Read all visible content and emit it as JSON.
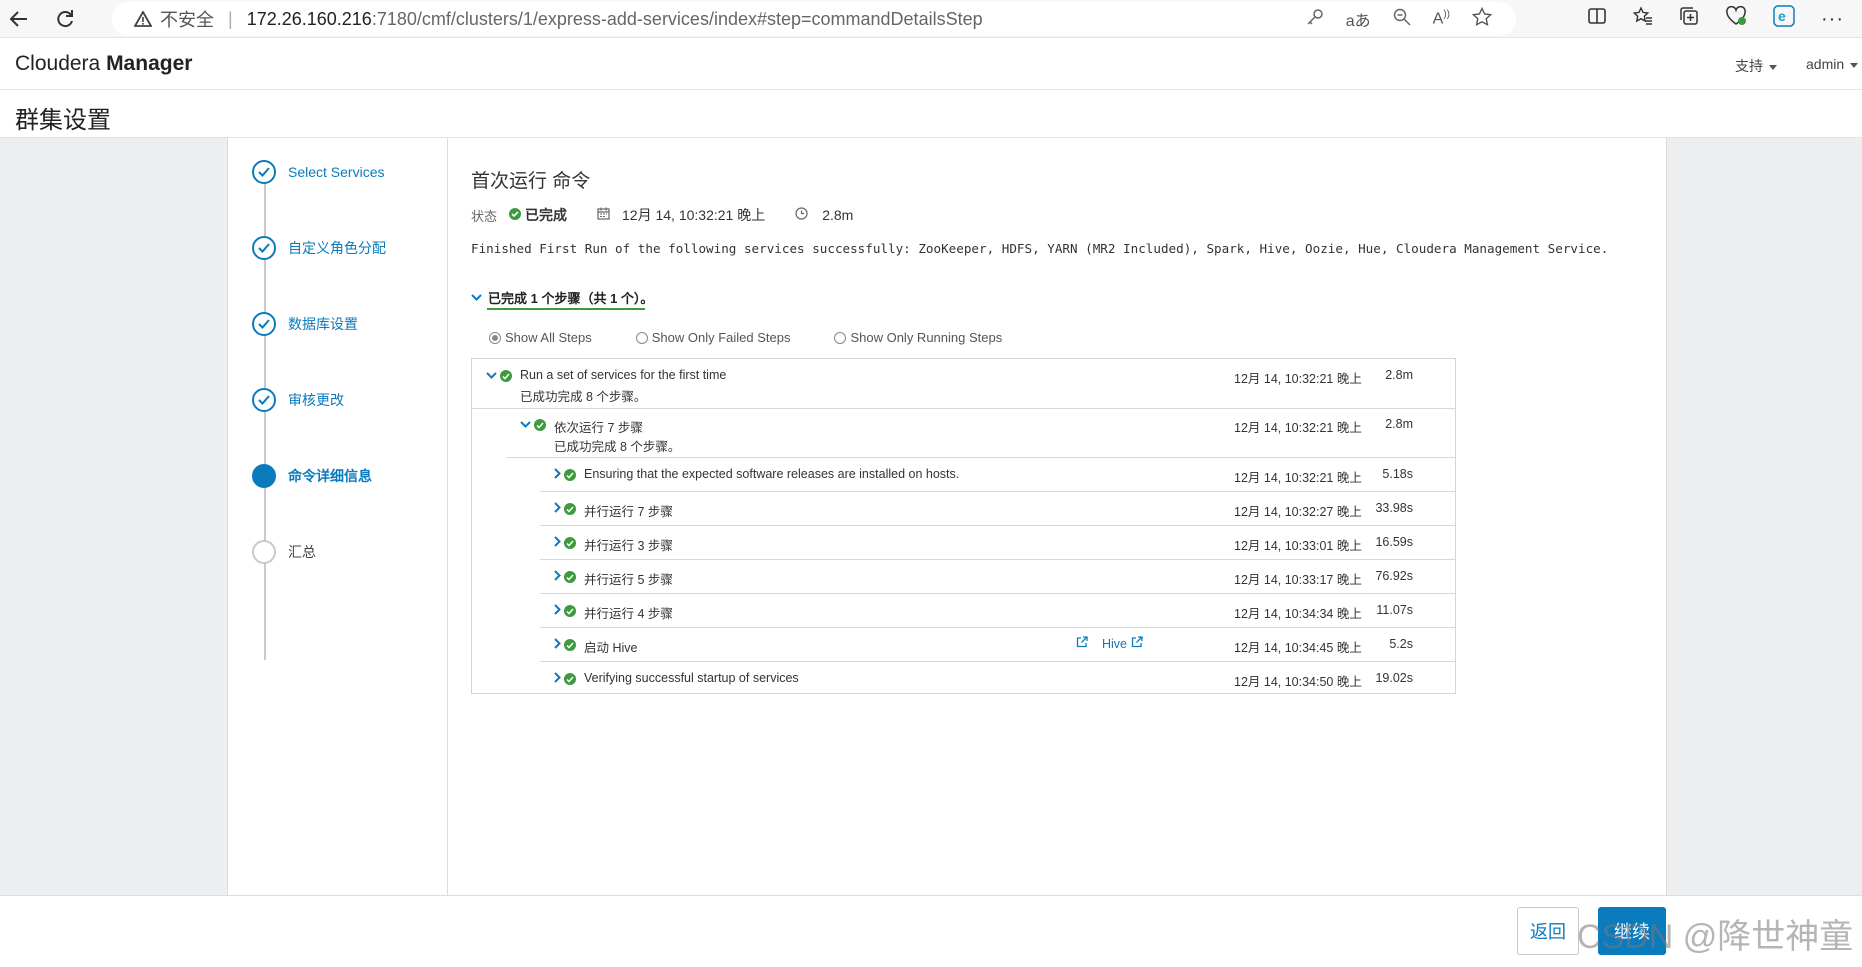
{
  "browser": {
    "insecure_label": "不安全",
    "url_host": "172.26.160.216",
    "url_path": ":7180/cmf/clusters/1/express-add-services/index#step=commandDetailsStep"
  },
  "header": {
    "brand_light": "Cloudera ",
    "brand_bold": "Manager",
    "support_label": "支持",
    "user_label": "admin"
  },
  "page": {
    "title": "群集设置"
  },
  "wizard_steps": [
    {
      "label": "Select Services",
      "state": "done"
    },
    {
      "label": "自定义角色分配",
      "state": "done"
    },
    {
      "label": "数据库设置",
      "state": "done"
    },
    {
      "label": "审核更改",
      "state": "done"
    },
    {
      "label": "命令详细信息",
      "state": "active"
    },
    {
      "label": "汇总",
      "state": "pending"
    }
  ],
  "command": {
    "title": "首次运行 命令",
    "status_label": "状态",
    "status_value": "已完成",
    "start_time": "12月 14, 10:32:21 晚上",
    "duration": "2.8m",
    "message": "Finished First Run of the following services successfully: ZooKeeper, HDFS, YARN (MR2 Included), Spark, Hive, Oozie, Hue, Cloudera Management Service.",
    "summary": "已完成 1 个步骤（共 1 个）。"
  },
  "filters": {
    "all": "Show All Steps",
    "failed": "Show Only Failed Steps",
    "running": "Show Only Running Steps",
    "selected": "all"
  },
  "steps": {
    "root": {
      "name": "Run a set of services for the first time",
      "sub": "已成功完成 8 个步骤。",
      "ts": "12月 14, 10:32:21 晚上",
      "dur": "2.8m"
    },
    "seq": {
      "name": "依次运行 7 步骤",
      "sub": "已成功完成 8 个步骤。",
      "ts": "12月 14, 10:32:21 晚上",
      "dur": "2.8m"
    },
    "children": [
      {
        "name": "Ensuring that the expected software releases are installed on hosts.",
        "ts": "12月 14, 10:32:21 晚上",
        "dur": "5.18s"
      },
      {
        "name": "并行运行 7 步骤",
        "ts": "12月 14, 10:32:27 晚上",
        "dur": "33.98s"
      },
      {
        "name": "并行运行 3 步骤",
        "ts": "12月 14, 10:33:01 晚上",
        "dur": "16.59s"
      },
      {
        "name": "并行运行 5 步骤",
        "ts": "12月 14, 10:33:17 晚上",
        "dur": "76.92s"
      },
      {
        "name": "并行运行 4 步骤",
        "ts": "12月 14, 10:34:34 晚上",
        "dur": "11.07s"
      },
      {
        "name": "启动 Hive",
        "ts": "12月 14, 10:34:45 晚上",
        "dur": "5.2s",
        "link": "Hive"
      },
      {
        "name": "Verifying successful startup of services",
        "ts": "12月 14, 10:34:50 晚上",
        "dur": "19.02s"
      }
    ]
  },
  "footer": {
    "back_label": "返回",
    "next_label": "继续",
    "watermark": "CSDN @降世神童"
  },
  "colors": {
    "accent": "#0a7bbd",
    "success": "#3d9a3d"
  }
}
